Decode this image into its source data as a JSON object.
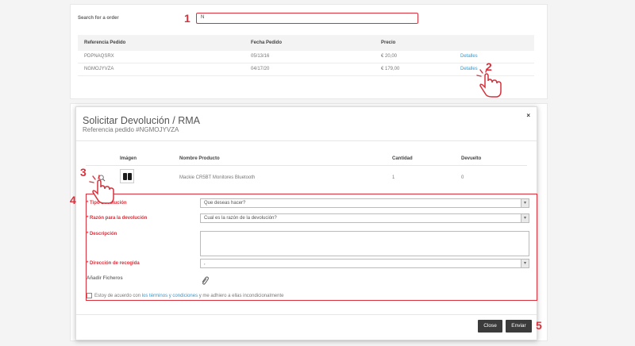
{
  "orders": {
    "search_label": "Search for a order",
    "search_value": "N",
    "columns": [
      "Referencia Pedido",
      "Fecha Pedido",
      "Precio"
    ],
    "rows": [
      {
        "ref": "PDPNAQSRX",
        "date": "05/13/16",
        "price": "€ 20,00",
        "action": "Detalles"
      },
      {
        "ref": "NGMOJYVZA",
        "date": "04/17/20",
        "price": "€ 179,00",
        "action": "Detalles"
      }
    ]
  },
  "annotations": {
    "n1": "1",
    "n2": "2",
    "n3": "3",
    "n4": "4",
    "n5": "5"
  },
  "modal": {
    "title": "Solicitar Devolución / RMA",
    "subtitle": "Referencia pedido #NGMOJYVZA",
    "close": "×",
    "columns": [
      "Imágen",
      "Nombre Producto",
      "Cantidad",
      "Devuelto"
    ],
    "product": {
      "name": "Mackie CR5BT Monitores Bluetooth",
      "quantity": "1",
      "returned": "0"
    },
    "form": {
      "tipo_label": "* Tipo Devolución",
      "tipo_value": "Que deseas hacer?",
      "razon_label": "* Razón para la devolución",
      "razon_value": "Cual es la razón de la devolución?",
      "descripcion_label": "* Descripción",
      "direccion_label": "* Dirección de recogida",
      "direccion_value": ",",
      "ficheros_label": "Añadir Ficheros",
      "terms_prefix": "Estoy de acuerdo con ",
      "terms_link": "los términos y condiciones",
      "terms_suffix": " y me adhiero a ellas incondicionalmente"
    },
    "buttons": {
      "close": "Close",
      "send": "Enviar"
    }
  },
  "colors": {
    "accent_red": "#d9303b",
    "link_blue": "#3a96c8",
    "button_dark": "#3b3b3b"
  }
}
